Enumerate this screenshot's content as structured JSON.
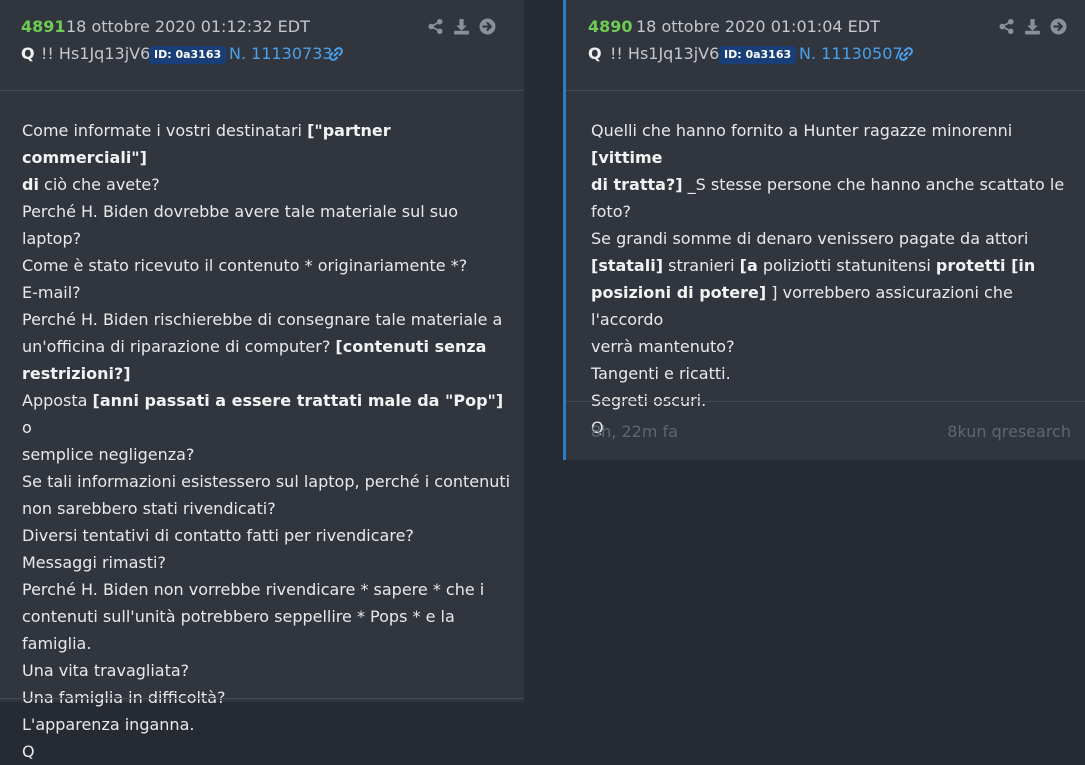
{
  "posts": [
    {
      "number": "4891",
      "date": "18 ottobre 2020 01:12:32 EDT",
      "author": "Q",
      "tripcode": "!! Hs1Jq13jV6",
      "id_badge": "ID: 0a3163",
      "ref": "N. 11130733",
      "lines": [
        [
          {
            "t": "Come informate i vostri destinatari "
          },
          {
            "t": "[\"partner commerciali\"]",
            "b": true
          }
        ],
        [
          {
            "t": "di",
            "b": true
          },
          {
            "t": " ciò che avete?"
          }
        ],
        [
          {
            "t": "Perché H. Biden dovrebbe avere tale materiale sul suo laptop?"
          }
        ],
        [
          {
            "t": "Come è stato ricevuto il contenuto * originariamente *?"
          }
        ],
        [
          {
            "t": "E-mail?"
          }
        ],
        [
          {
            "t": "Perché H. Biden rischierebbe di consegnare tale materiale a"
          }
        ],
        [
          {
            "t": "un'officina di riparazione di computer? "
          },
          {
            "t": "[contenuti senza",
            "b": true
          }
        ],
        [
          {
            "t": "restrizioni?]",
            "b": true
          }
        ],
        [
          {
            "t": "Apposta "
          },
          {
            "t": "[anni passati a essere trattati male da \"Pop\"]",
            "b": true
          },
          {
            "t": " o"
          }
        ],
        [
          {
            "t": "semplice negligenza?"
          }
        ],
        [
          {
            "t": "Se tali informazioni esistessero sul laptop, perché i contenuti"
          }
        ],
        [
          {
            "t": "non sarebbero stati rivendicati?"
          }
        ],
        [
          {
            "t": "Diversi tentativi di contatto fatti per rivendicare?"
          }
        ],
        [
          {
            "t": "Messaggi rimasti?"
          }
        ],
        [
          {
            "t": "Perché H. Biden non vorrebbe rivendicare * sapere * che i"
          }
        ],
        [
          {
            "t": "contenuti sull'unità potrebbero seppellire * Pops * e la"
          }
        ],
        [
          {
            "t": "famiglia."
          }
        ],
        [
          {
            "t": "Una vita travagliata?"
          }
        ],
        [
          {
            "t": "Una famiglia in difficoltà?"
          }
        ],
        [
          {
            "t": "L'apparenza inganna."
          }
        ],
        [
          {
            "t": "Q"
          }
        ]
      ]
    },
    {
      "number": "4890",
      "date": "18 ottobre 2020 01:01:04 EDT",
      "author": "Q",
      "tripcode": "!! Hs1Jq13jV6",
      "id_badge": "ID: 0a3163",
      "ref": "N. 11130507",
      "lines": [
        [
          {
            "t": "Quelli che hanno fornito a Hunter ragazze minorenni "
          },
          {
            "t": "[vittime",
            "b": true
          }
        ],
        [
          {
            "t": "di tratta?]",
            "b": true
          },
          {
            "t": " _S stesse persone che hanno anche scattato le"
          }
        ],
        [
          {
            "t": "foto?"
          }
        ],
        [
          {
            "t": "Se grandi somme di denaro venissero pagate da attori"
          }
        ],
        [
          {
            "t": "[statali]",
            "b": true
          },
          {
            "t": " stranieri "
          },
          {
            "t": "[a",
            "b": true
          },
          {
            "t": " poliziotti statunitensi "
          },
          {
            "t": "protetti [in",
            "b": true
          }
        ],
        [
          {
            "t": "posizioni di potere]",
            "b": true
          },
          {
            "t": " ] vorrebbero assicurazioni che l'accordo"
          }
        ],
        [
          {
            "t": "verrà mantenuto?"
          }
        ],
        [
          {
            "t": "Tangenti e ricatti."
          }
        ],
        [
          {
            "t": "Segreti oscuri."
          }
        ],
        [
          {
            "t": "Q"
          }
        ]
      ],
      "footer_time": "8h, 22m fa",
      "footer_source": "8kun qresearch"
    }
  ],
  "icons": [
    "share-icon",
    "download-icon",
    "arrow-right-circle-icon",
    "link-icon"
  ],
  "colors": {
    "post_number": "#6fcc52",
    "link": "#4aa0e8",
    "badge": "#1a3f78",
    "accent_border": "#2e7bc6",
    "background": "#262a32",
    "card": "#31353e"
  }
}
